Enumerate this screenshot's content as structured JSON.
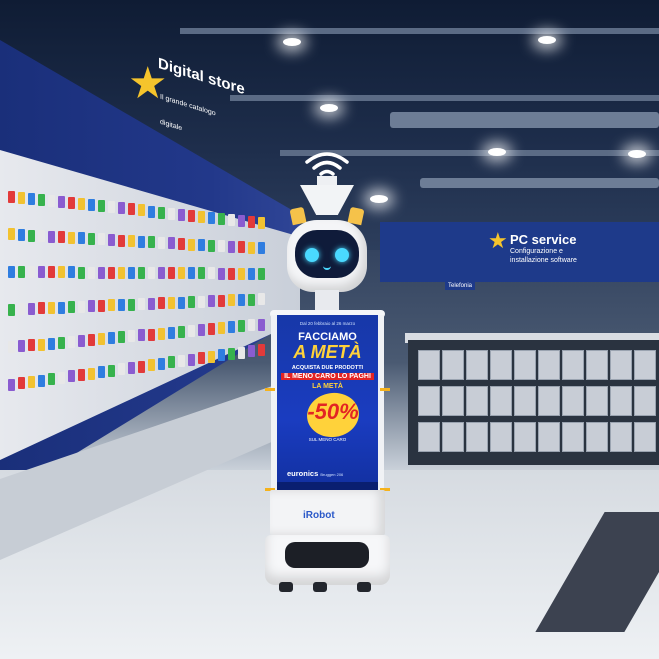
{
  "store_signage": {
    "left_sign_title": "Digital store",
    "left_sign_subtitle": "Il grande catalogo",
    "left_sign_line3": "digitale",
    "back_sign_title": "PC service",
    "back_sign_line2": "Configurazione e",
    "back_sign_line3": "installazione software",
    "back_hanging_label": "Telefonia"
  },
  "robot": {
    "brand_label": "iRobot",
    "wifi_icon": "wifi-icon"
  },
  "poster": {
    "dates": "Dal 20 febbraio al 26 marzo",
    "headline_line1": "FACCIAMO",
    "headline_line2": "A METÀ",
    "offer_line1": "ACQUISTA DUE PRODOTTI",
    "offer_line2": "IL MENO CARO LO PAGHI",
    "offer_line3": "LA METÀ",
    "discount": "-50%",
    "discount_note": "SUL MENO CARO",
    "retailer": "euronics",
    "retailer_suffix": "Bruggen 206"
  },
  "colors": {
    "brand_blue": "#1a3cc0",
    "accent_yellow": "#ffd23a",
    "accent_red": "#e32424",
    "robot_face_glow": "#4ad9ff"
  }
}
